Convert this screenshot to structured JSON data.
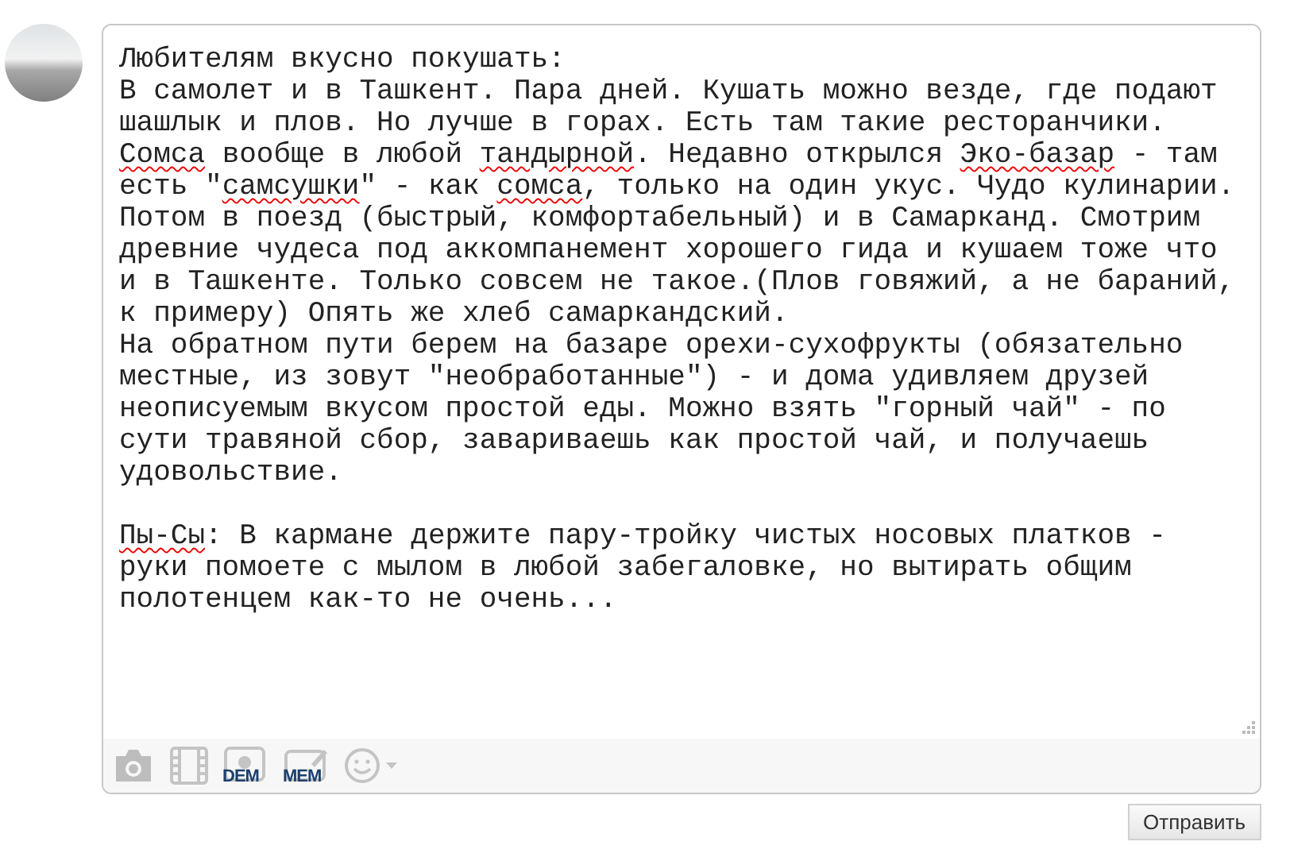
{
  "comment_editor": {
    "paragraphs": [
      [
        [
          {
            "t": "Любителям вкусно покушать:",
            "misspelled": false
          }
        ],
        [
          {
            "t": "В самолет и в Ташкент. Пара дней. Кушать можно везде, где подают",
            "misspelled": false
          }
        ],
        [
          {
            "t": "шашлык и плов. Но лучше в горах. Есть там такие ресторанчики.",
            "misspelled": false
          }
        ],
        [
          {
            "t": "Сомса",
            "misspelled": true
          },
          {
            "t": " вообще в любой ",
            "misspelled": false
          },
          {
            "t": "тандырной",
            "misspelled": true
          },
          {
            "t": ". Недавно открылся ",
            "misspelled": false
          },
          {
            "t": "Эко-базар",
            "misspelled": true
          },
          {
            "t": " - там",
            "misspelled": false
          }
        ],
        [
          {
            "t": "есть \"",
            "misspelled": false
          },
          {
            "t": "самсушки",
            "misspelled": true
          },
          {
            "t": "\" - как ",
            "misspelled": false
          },
          {
            "t": "сомса",
            "misspelled": true
          },
          {
            "t": ", только на один укус. Чудо кулинарии.",
            "misspelled": false
          }
        ],
        [
          {
            "t": "Потом в поезд (быстрый, комфортабельный) и в Самарканд. Смотрим",
            "misspelled": false
          }
        ],
        [
          {
            "t": "древние чудеса под аккомпанемент хорошего гида и кушаем тоже что",
            "misspelled": false
          }
        ],
        [
          {
            "t": "и в Ташкенте. Только совсем не такое.(Плов говяжий, а не бараний,",
            "misspelled": false
          }
        ],
        [
          {
            "t": "к примеру) Опять же хлеб самаркандский.",
            "misspelled": false
          }
        ],
        [
          {
            "t": "На обратном пути берем на базаре орехи-сухофрукты (обязательно",
            "misspelled": false
          }
        ],
        [
          {
            "t": "местные, из зовут \"необработанные\") - и дома удивляем друзей",
            "misspelled": false
          }
        ],
        [
          {
            "t": "неописуемым вкусом простой еды. Можно взять \"горный чай\" - по",
            "misspelled": false
          }
        ],
        [
          {
            "t": "сути травяной сбор, завариваешь как простой чай, и получаешь",
            "misspelled": false
          }
        ],
        [
          {
            "t": "удовольствие.",
            "misspelled": false
          }
        ]
      ],
      [
        [
          {
            "t": "Пы-Сы",
            "misspelled": true
          },
          {
            "t": ": В кармане держите пару-тройку чистых носовых платков -",
            "misspelled": false
          }
        ],
        [
          {
            "t": "руки помоете с мылом в любой забегаловке, но вытирать общим",
            "misspelled": false
          }
        ],
        [
          {
            "t": "полотенцем как-то не очень...",
            "misspelled": false
          }
        ]
      ]
    ],
    "toolbar": [
      {
        "kind": "camera"
      },
      {
        "kind": "film"
      },
      {
        "kind": "dem",
        "label": "DEM"
      },
      {
        "kind": "mem",
        "label": "MEM"
      },
      {
        "kind": "smiley"
      }
    ]
  },
  "submit_button": "Отправить"
}
